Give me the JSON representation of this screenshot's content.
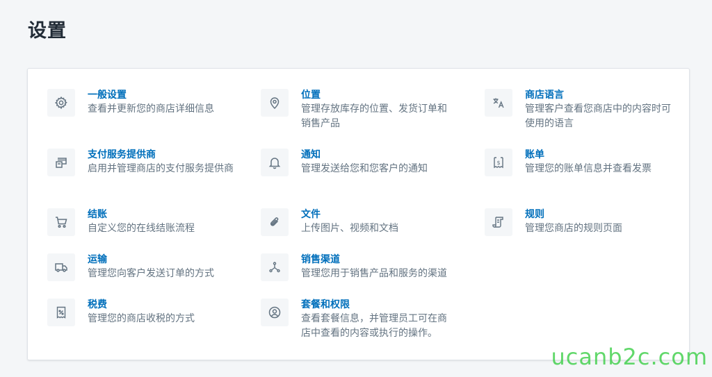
{
  "page": {
    "title": "设置"
  },
  "settings": {
    "general": {
      "title": "一般设置",
      "desc": "查看并更新您的商店详细信息",
      "icon": "gear-icon"
    },
    "locations": {
      "title": "位置",
      "desc": "管理存放库存的位置、发货订单和销售产品",
      "icon": "location-pin-icon"
    },
    "languages": {
      "title": "商店语言",
      "desc": "管理客户查看您商店中的内容时可使用的语言",
      "icon": "translate-icon"
    },
    "payments": {
      "title": "支付服务提供商",
      "desc": "启用并管理商店的支付服务提供商",
      "icon": "payment-card-icon"
    },
    "notifications": {
      "title": "通知",
      "desc": "管理发送给您和您客户的通知",
      "icon": "bell-icon"
    },
    "billing": {
      "title": "账单",
      "desc": "管理您的账单信息并查看发票",
      "icon": "billing-receipt-icon"
    },
    "checkout": {
      "title": "结账",
      "desc": "自定义您的在线结账流程",
      "icon": "cart-icon"
    },
    "files": {
      "title": "文件",
      "desc": "上传图片、视频和文档",
      "icon": "paperclip-icon"
    },
    "policies": {
      "title": "规则",
      "desc": "管理您商店的规则页面",
      "icon": "policy-document-icon"
    },
    "shipping": {
      "title": "运输",
      "desc": "管理您向客户发送订单的方式",
      "icon": "truck-icon"
    },
    "channels": {
      "title": "销售渠道",
      "desc": "管理您用于销售产品和服务的渠道",
      "icon": "channels-icon"
    },
    "taxes": {
      "title": "税费",
      "desc": "管理您的商店收税的方式",
      "icon": "tax-receipt-icon"
    },
    "plan": {
      "title": "套餐和权限",
      "desc": "查看套餐信息，并管理员工可在商店中查看的内容或执行的操作。",
      "icon": "user-circle-icon"
    }
  },
  "watermark": "ucanb2c.com",
  "colors": {
    "link": "#006fbb",
    "muted": "#637381",
    "icon": "#637381",
    "background": "#f4f6f8"
  }
}
